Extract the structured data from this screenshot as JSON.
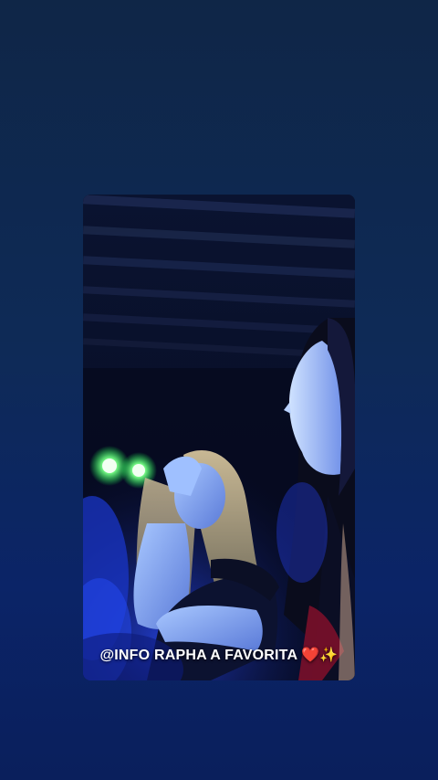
{
  "story": {
    "caption": "@INFO RAPHA A FAVORITA ❤️✨"
  },
  "colors": {
    "background_top": "#0f2647",
    "background_bottom": "#0a1f5c",
    "stage_light_green": "#7dff8a",
    "stage_light_blue": "#3a5bff"
  }
}
